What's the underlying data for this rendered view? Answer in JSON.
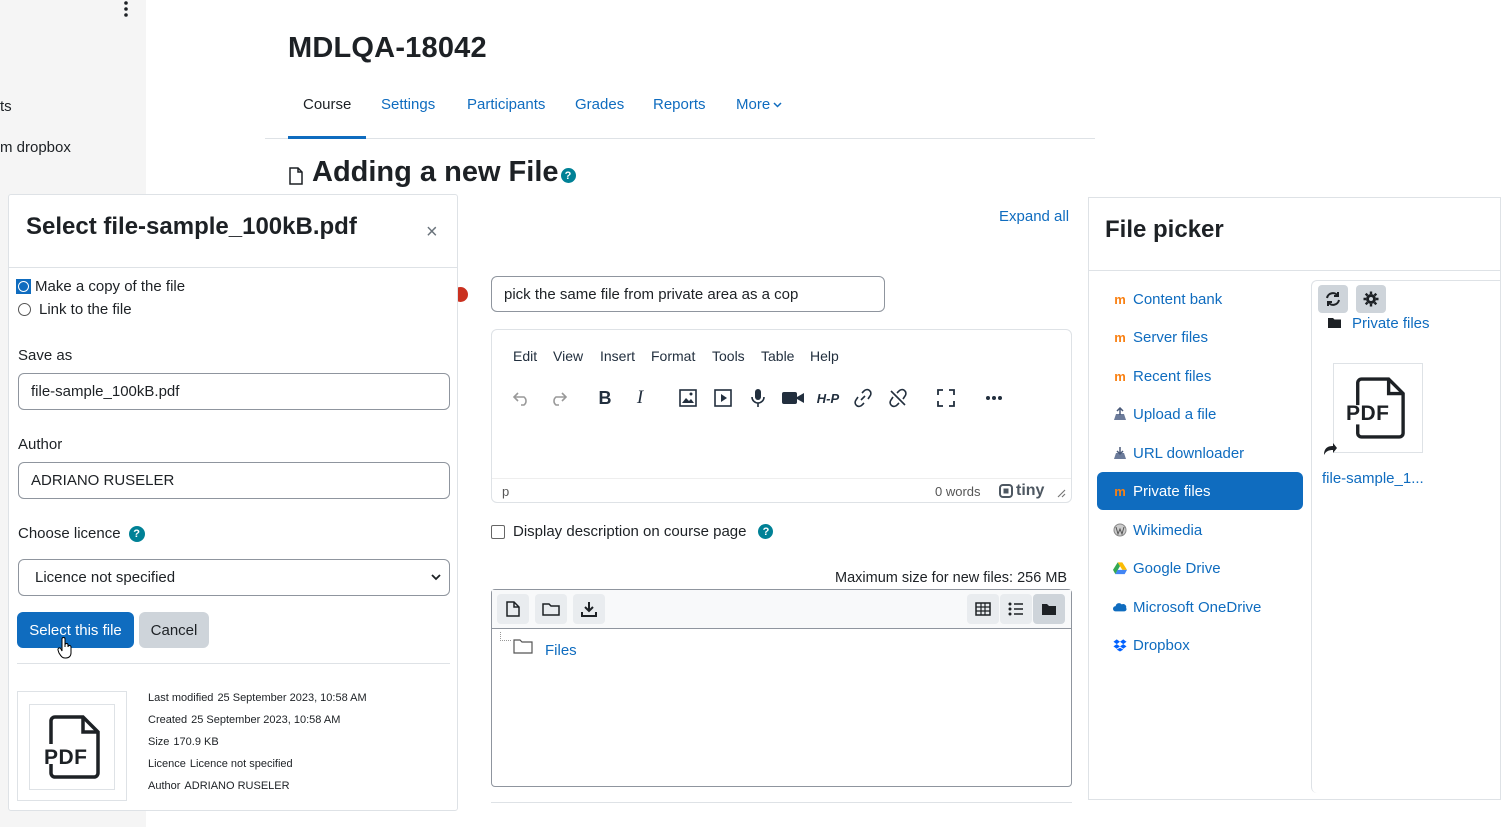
{
  "drawer": {
    "items": [
      "ts",
      "m dropbox"
    ]
  },
  "course": {
    "title": "MDLQA-18042"
  },
  "nav": {
    "tabs": [
      "Course",
      "Settings",
      "Participants",
      "Grades",
      "Reports"
    ],
    "more": "More"
  },
  "page": {
    "heading": "Adding a new File",
    "expand_all": "Expand all"
  },
  "form": {
    "name_value": "pick the same file from private area as a cop",
    "editor_menu": [
      "Edit",
      "View",
      "Insert",
      "Format",
      "Tools",
      "Table",
      "Help"
    ],
    "editor_path": "p",
    "editor_words": "0 words",
    "editor_brand": "tiny",
    "display_desc_label": "Display description on course page",
    "max_size": "Maximum size for new files: 256 MB",
    "folder_label": "Files"
  },
  "modal": {
    "title": "Select file-sample_100kB.pdf",
    "close": "×",
    "option_copy": "Make a copy of the file",
    "option_link": "Link to the file",
    "save_as_label": "Save as",
    "save_as_value": "file-sample_100kB.pdf",
    "author_label": "Author",
    "author_value": "ADRIANO RUSELER",
    "licence_label": "Choose licence",
    "licence_value": "Licence not specified",
    "select_button": "Select this file",
    "cancel_button": "Cancel",
    "meta": [
      {
        "key": "Last modified",
        "value": "25 September 2023, 10:58 AM"
      },
      {
        "key": "Created",
        "value": "25 September 2023, 10:58 AM"
      },
      {
        "key": "Size",
        "value": "170.9 KB"
      },
      {
        "key": "Licence",
        "value": "Licence not specified"
      },
      {
        "key": "Author",
        "value": "ADRIANO RUSELER"
      }
    ],
    "preview_text": "PDF"
  },
  "filepicker": {
    "title": "File picker",
    "repositories": [
      "Content bank",
      "Server files",
      "Recent files",
      "Upload a file",
      "URL downloader",
      "Private files",
      "Wikimedia",
      "Google Drive",
      "Microsoft OneDrive",
      "Dropbox"
    ],
    "active_repository": "Private files",
    "breadcrumb": "Private files",
    "file_name": "file-sample_1...",
    "file_icon_text": "PDF"
  },
  "colors": {
    "primary": "#0f6cbf",
    "help": "#008196",
    "required": "#ca3120"
  }
}
